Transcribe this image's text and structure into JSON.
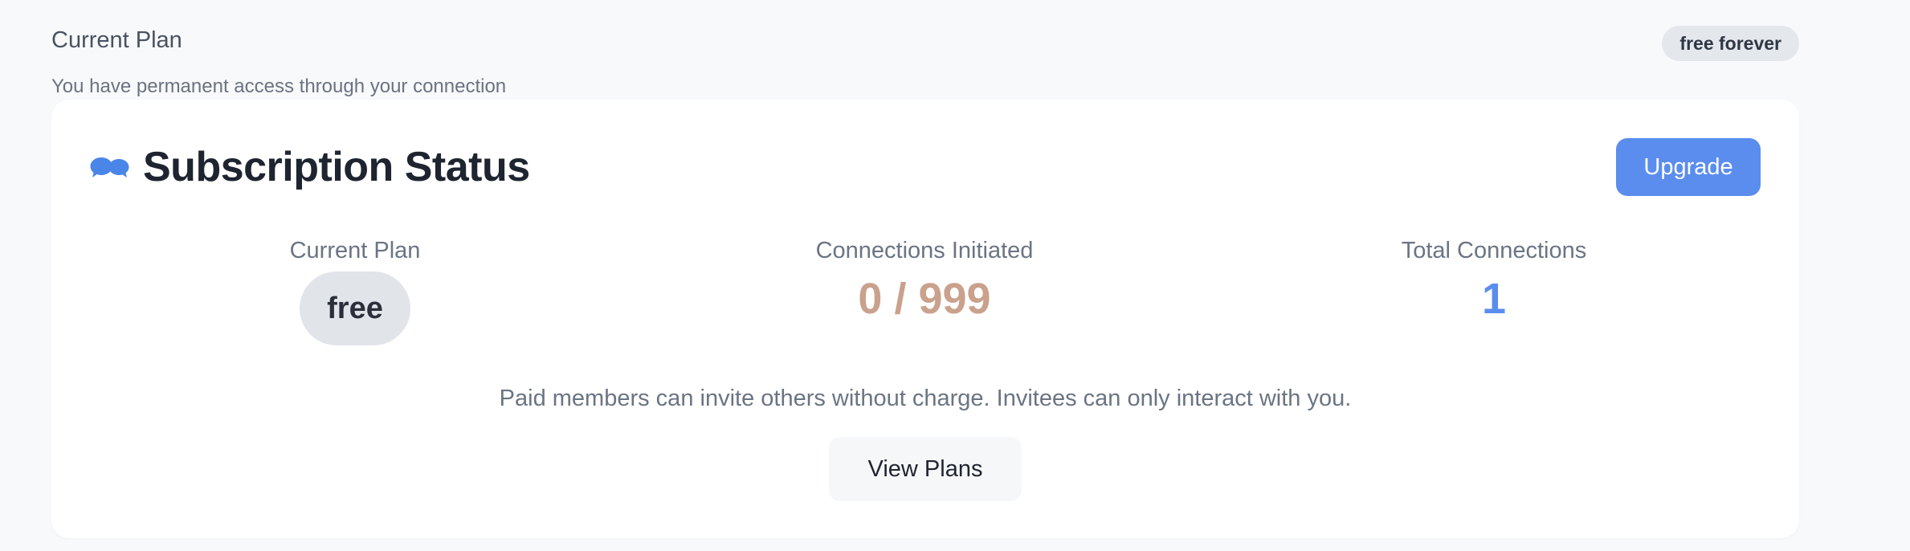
{
  "plan_section": {
    "title": "Current Plan",
    "badge": "free forever",
    "subtitle": "You have permanent access through your connection"
  },
  "card": {
    "icon": "chat-bubbles-icon",
    "title": "Subscription Status",
    "upgrade_label": "Upgrade",
    "stats": {
      "current_plan": {
        "label": "Current Plan",
        "value": "free"
      },
      "connections_initiated": {
        "label": "Connections Initiated",
        "value": "0 / 999"
      },
      "total_connections": {
        "label": "Total Connections",
        "value": "1"
      }
    },
    "note": "Paid members can invite others without charge. Invitees can only interact with you.",
    "view_plans_label": "View Plans"
  },
  "colors": {
    "accent": "#5a8ded",
    "initiated_value": "#c9a18c",
    "background": "#f8f9fb",
    "card_background": "#ffffff"
  }
}
